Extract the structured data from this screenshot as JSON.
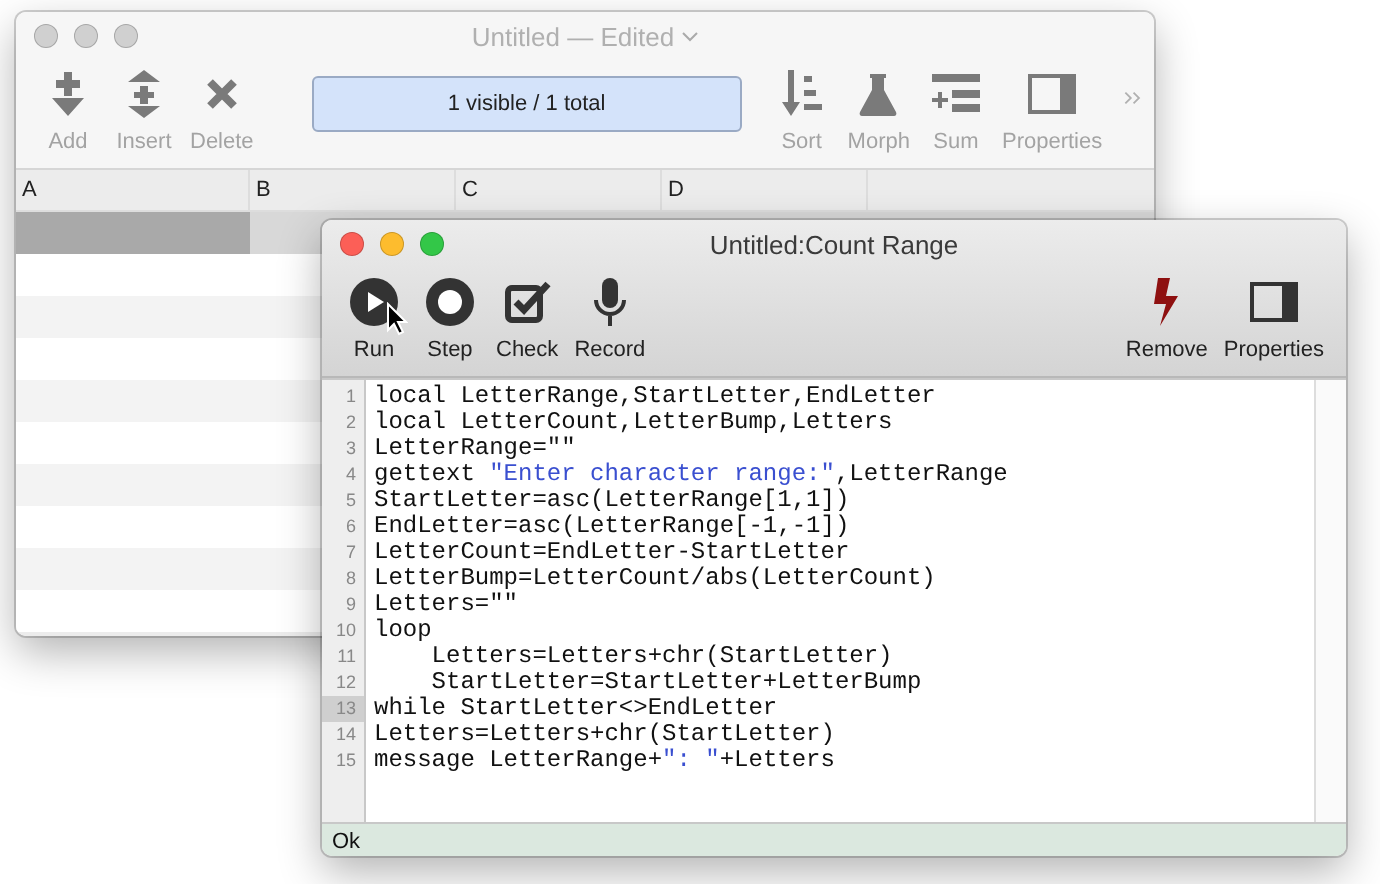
{
  "back_window": {
    "title": "Untitled — Edited",
    "active": false,
    "toolbar_left": [
      "Add",
      "Insert",
      "Delete"
    ],
    "filter_status": "1 visible / 1 total",
    "toolbar_right": [
      "Sort",
      "Morph",
      "Sum",
      "Properties"
    ],
    "table": {
      "columns": [
        "A",
        "B",
        "C",
        "D"
      ],
      "rows": [
        {
          "selected": true
        },
        {
          "selected": false
        },
        {
          "selected": false
        },
        {
          "selected": false
        },
        {
          "selected": false
        },
        {
          "selected": false
        },
        {
          "selected": false
        },
        {
          "selected": false
        },
        {
          "selected": false
        },
        {
          "selected": false
        }
      ]
    }
  },
  "front_window": {
    "title": "Untitled:Count Range",
    "active": true,
    "toolbar_left": [
      "Run",
      "Step",
      "Check",
      "Record"
    ],
    "toolbar_right": [
      "Remove",
      "Properties"
    ],
    "lines": [
      {
        "number": "1",
        "current": false,
        "parts": [
          {
            "kind": "code",
            "text": "local LetterRange,StartLetter,EndLetter"
          }
        ]
      },
      {
        "number": "2",
        "current": false,
        "parts": [
          {
            "kind": "code",
            "text": "local LetterCount,LetterBump,Letters"
          }
        ]
      },
      {
        "number": "3",
        "current": false,
        "parts": [
          {
            "kind": "code",
            "text": "LetterRange=\"\""
          }
        ]
      },
      {
        "number": "4",
        "current": false,
        "parts": [
          {
            "kind": "code",
            "text": "gettext "
          },
          {
            "kind": "string",
            "text": "\"Enter character range:\""
          },
          {
            "kind": "code",
            "text": ",LetterRange"
          }
        ]
      },
      {
        "number": "5",
        "current": false,
        "parts": [
          {
            "kind": "code",
            "text": "StartLetter=asc(LetterRange[1,1])"
          }
        ]
      },
      {
        "number": "6",
        "current": false,
        "parts": [
          {
            "kind": "code",
            "text": "EndLetter=asc(LetterRange[-1,-1])"
          }
        ]
      },
      {
        "number": "7",
        "current": false,
        "parts": [
          {
            "kind": "code",
            "text": "LetterCount=EndLetter-StartLetter"
          }
        ]
      },
      {
        "number": "8",
        "current": false,
        "parts": [
          {
            "kind": "code",
            "text": "LetterBump=LetterCount/abs(LetterCount)"
          }
        ]
      },
      {
        "number": "9",
        "current": false,
        "parts": [
          {
            "kind": "code",
            "text": "Letters=\"\""
          }
        ]
      },
      {
        "number": "10",
        "current": false,
        "parts": [
          {
            "kind": "code",
            "text": "loop"
          }
        ]
      },
      {
        "number": "11",
        "current": false,
        "parts": [
          {
            "kind": "code",
            "text": "    Letters=Letters+chr(StartLetter)"
          }
        ]
      },
      {
        "number": "12",
        "current": false,
        "parts": [
          {
            "kind": "code",
            "text": "    StartLetter=StartLetter+LetterBump"
          }
        ]
      },
      {
        "number": "13",
        "current": true,
        "parts": [
          {
            "kind": "code",
            "text": "while StartLetter<>EndLetter"
          }
        ]
      },
      {
        "number": "14",
        "current": false,
        "parts": [
          {
            "kind": "code",
            "text": "Letters=Letters+chr(StartLetter)"
          }
        ]
      },
      {
        "number": "15",
        "current": false,
        "parts": [
          {
            "kind": "code",
            "text": "message LetterRange+"
          },
          {
            "kind": "string",
            "text": "\": \""
          },
          {
            "kind": "code",
            "text": "+Letters"
          }
        ]
      }
    ],
    "status_bar": "Ok"
  }
}
